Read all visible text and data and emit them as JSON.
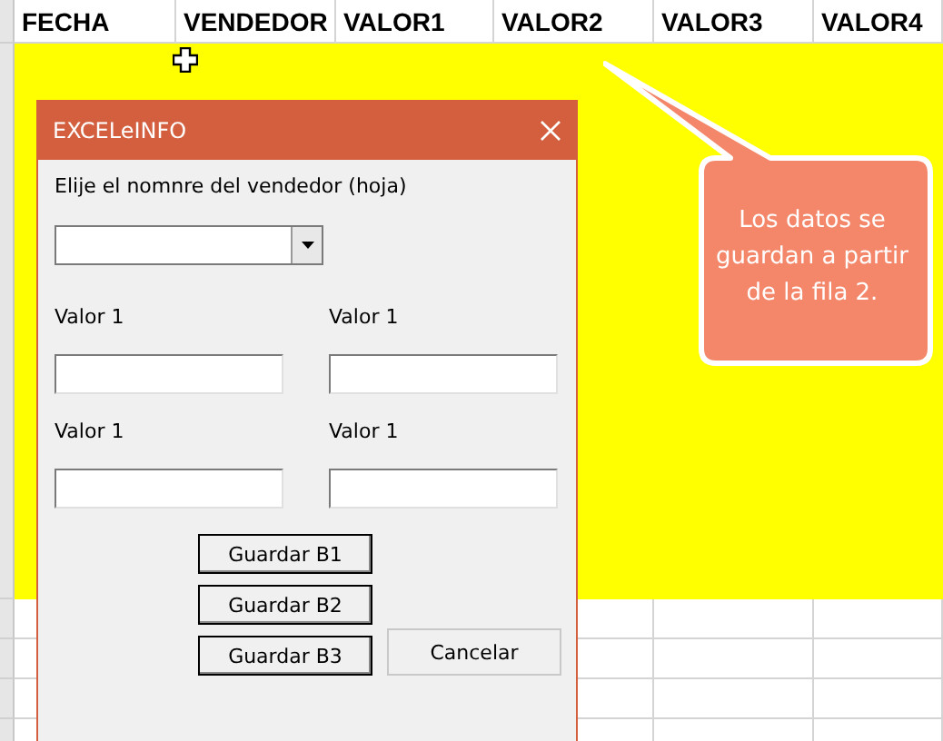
{
  "columns": [
    "FECHA",
    "VENDEDOR",
    "VALOR1",
    "VALOR2",
    "VALOR3",
    "VALOR4"
  ],
  "dialog": {
    "title": "EXCELeINFO",
    "prompt": "Elije el nomnre del vendedor (hoja)",
    "fields": [
      {
        "label": "Valor 1"
      },
      {
        "label": "Valor 1"
      },
      {
        "label": "Valor 1"
      },
      {
        "label": "Valor 1"
      }
    ],
    "buttons": [
      {
        "label": "Guardar B1",
        "kind": "save"
      },
      {
        "label": "Guardar B2",
        "kind": "save"
      },
      {
        "label": "Guardar B3",
        "kind": "save"
      },
      {
        "label": "Cancelar",
        "kind": "cancel"
      }
    ]
  },
  "callout": {
    "text": "Los datos se guardan a partir de la fila 2."
  }
}
